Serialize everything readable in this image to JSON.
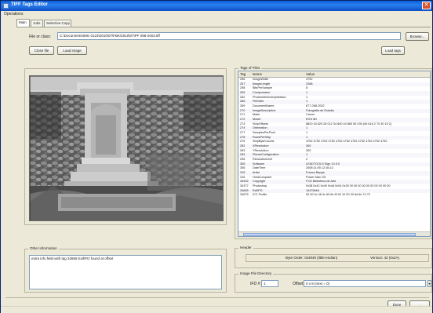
{
  "window": {
    "title": "TIFF Tags Editor",
    "close_glyph": "✕"
  },
  "menu": {
    "operations": "Operations"
  },
  "tabs": [
    {
      "label": "Main"
    },
    {
      "label": "Jobs"
    },
    {
      "label": "Selective Copy"
    }
  ],
  "file": {
    "label": "File or class:",
    "path": "C:\\Documents\\IMG 0123\\2010\\07\\FBK\\2010\\07\\PF 098-2002.tiff",
    "browse": "Browse..."
  },
  "buttons": {
    "close_file": "Close file",
    "load_image": "Load image",
    "load_tags": "Load tags",
    "done": "Done",
    "disabled_right": "..."
  },
  "tags_group": {
    "title": "Tags of Files",
    "columns": [
      "Tag",
      "Name",
      "Value"
    ],
    "rows": [
      {
        "tag": "256",
        "name": "ImageWidth",
        "value": "4752"
      },
      {
        "tag": "257",
        "name": "ImageLength",
        "value": "3168"
      },
      {
        "tag": "258",
        "name": "BitsPerSample",
        "value": "8"
      },
      {
        "tag": "259",
        "name": "Compression",
        "value": "1"
      },
      {
        "tag": "262",
        "name": "PhotometricInterpretation",
        "value": "1"
      },
      {
        "tag": "266",
        "name": "FillOrder",
        "value": "1"
      },
      {
        "tag": "269",
        "name": "DocumentName",
        "value": "677-098-2002"
      },
      {
        "tag": "270",
        "name": "ImageDescription",
        "value": "Fotografia de Estudio"
      },
      {
        "tag": "271",
        "name": "Make",
        "value": "Canon"
      },
      {
        "tag": "272",
        "name": "Model",
        "value": "EOS 5D"
      },
      {
        "tag": "273",
        "name": "StripOffsets",
        "value": "8820 16 820 28 012 34 840 44 860 55 000 (06 616 2 70 30 19 2)"
      },
      {
        "tag": "274",
        "name": "Orientation",
        "value": "1"
      },
      {
        "tag": "277",
        "name": "SamplesPerPixel",
        "value": "1"
      },
      {
        "tag": "278",
        "name": "RowsPerStrip",
        "value": "1"
      },
      {
        "tag": "279",
        "name": "StripByteCounts",
        "value": "4752 4752 4752 4752 4752 4752 4752 4752 4752 4752 4752"
      },
      {
        "tag": "282",
        "name": "XResolution",
        "value": "300"
      },
      {
        "tag": "283",
        "name": "YResolution",
        "value": "300"
      },
      {
        "tag": "284",
        "name": "PlanarConfiguration",
        "value": "1"
      },
      {
        "tag": "296",
        "name": "ResolutionUnit",
        "value": "2"
      },
      {
        "tag": "305",
        "name": "Software",
        "value": "LEADTOOLS Sign 13.5.0"
      },
      {
        "tag": "306",
        "name": "DateTime",
        "value": "2008:11:05 12:16:13"
      },
      {
        "tag": "315",
        "name": "Artist",
        "value": "Franco Beppe"
      },
      {
        "tag": "316",
        "name": "HostComputer",
        "value": "Power Mac G5"
      },
      {
        "tag": "33432",
        "name": "Copyright",
        "value": "FCD Biblioteca de Arte"
      },
      {
        "tag": "34377",
        "name": "Photoshop",
        "value": "0x38 0x42 0x49 0x4d 0x04 0x25 00 00 00 00 00 00 00 00 00 00"
      },
      {
        "tag": "34665",
        "name": "ExifIFD",
        "value": "14476464"
      },
      {
        "tag": "34675",
        "name": "ICC Profile",
        "value": "00 00 0c 48 4c 69 6e 6f 02 10 00 00 6d 6e 74 72"
      }
    ]
  },
  "other_info": {
    "title": "Other information",
    "text": "extra info field with tag 34665 ExifIFD found at offset"
  },
  "header": {
    "title": "Header",
    "byte_order": "Byte Order: 0x4949 (little-endian)",
    "version": "Version: 42 (0x2A)"
  },
  "ifd": {
    "title": "Image File Directory",
    "ifd_label": "IFD #:",
    "ifd_value": "1",
    "offset_label": "Offset:",
    "offset_value": "0 x 8 (next = 0)"
  }
}
